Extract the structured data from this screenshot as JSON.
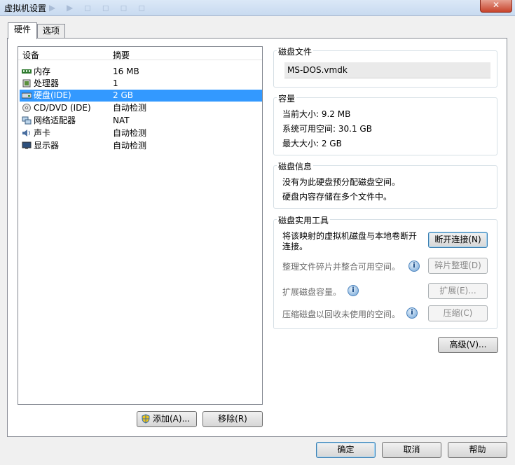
{
  "window": {
    "title": "虚拟机设置",
    "ghost_text": "▶ ▶ ◻ ◻ ◻ ◻",
    "close_label": "✕"
  },
  "tabs": [
    {
      "label": "硬件"
    },
    {
      "label": "选项"
    }
  ],
  "device_list": {
    "col_device": "设备",
    "col_summary": "摘要",
    "rows": [
      {
        "name": "内存",
        "summary": "16 MB"
      },
      {
        "name": "处理器",
        "summary": "1"
      },
      {
        "name": "硬盘(IDE)",
        "summary": "2 GB"
      },
      {
        "name": "CD/DVD (IDE)",
        "summary": "自动检测"
      },
      {
        "name": "网络适配器",
        "summary": "NAT"
      },
      {
        "name": "声卡",
        "summary": "自动检测"
      },
      {
        "name": "显示器",
        "summary": "自动检测"
      }
    ],
    "add_button": "添加(A)...",
    "remove_button": "移除(R)"
  },
  "disk_file": {
    "title": "磁盘文件",
    "value": "MS-DOS.vmdk"
  },
  "capacity": {
    "title": "容量",
    "current": "当前大小: 9.2 MB",
    "available": "系统可用空间: 30.1 GB",
    "max": "最大大小: 2 GB"
  },
  "disk_info": {
    "title": "磁盘信息",
    "line1": "没有为此硬盘预分配磁盘空间。",
    "line2": "硬盘内容存储在多个文件中。"
  },
  "utilities": {
    "title": "磁盘实用工具",
    "map_text_1": "将该映射的虚拟机磁盘与本地卷断开",
    "map_text_2": "连接。",
    "disconnect_button": "断开连接(N)",
    "defrag_text": "整理文件碎片并整合可用空间。",
    "defrag_button": "碎片整理(D)",
    "expand_text": "扩展磁盘容量。",
    "expand_button": "扩展(E)...",
    "compact_text": "压缩磁盘以回收未使用的空间。",
    "compact_button": "压缩(C)"
  },
  "advanced_button": "高级(V)...",
  "footer": {
    "ok": "确定",
    "cancel": "取消",
    "help": "帮助"
  }
}
